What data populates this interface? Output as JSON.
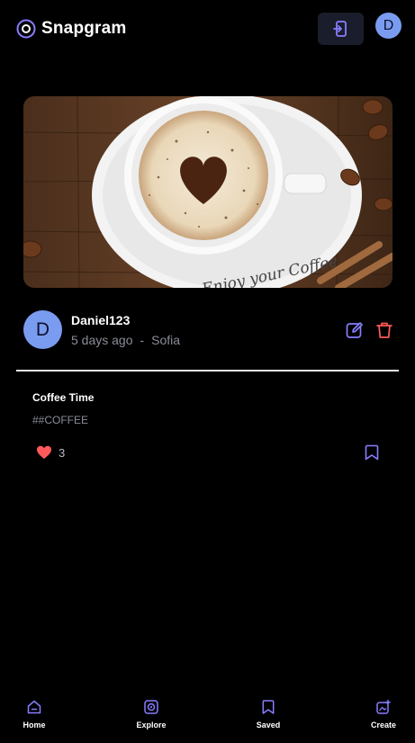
{
  "app": {
    "name": "Snapgram"
  },
  "header": {
    "avatar_initial": "D"
  },
  "post": {
    "image_text": "Enjoy your Coffee",
    "author": {
      "initial": "D",
      "name": "Daniel123",
      "time": "5 days ago",
      "separator": "-",
      "location": "Sofia"
    },
    "caption": "Coffee Time",
    "tags": "##COFFEE",
    "likes": "3"
  },
  "nav": {
    "items": [
      {
        "label": "Home",
        "icon": "home-icon"
      },
      {
        "label": "Explore",
        "icon": "explore-icon"
      },
      {
        "label": "Saved",
        "icon": "bookmark-icon"
      },
      {
        "label": "Create",
        "icon": "create-icon"
      }
    ]
  },
  "colors": {
    "background": "#000000",
    "accent": "#877eff",
    "avatar": "#7a9cf0",
    "delete": "#ff5a5a",
    "like": "#ff5a5a",
    "muted_text": "#8a8c99"
  }
}
